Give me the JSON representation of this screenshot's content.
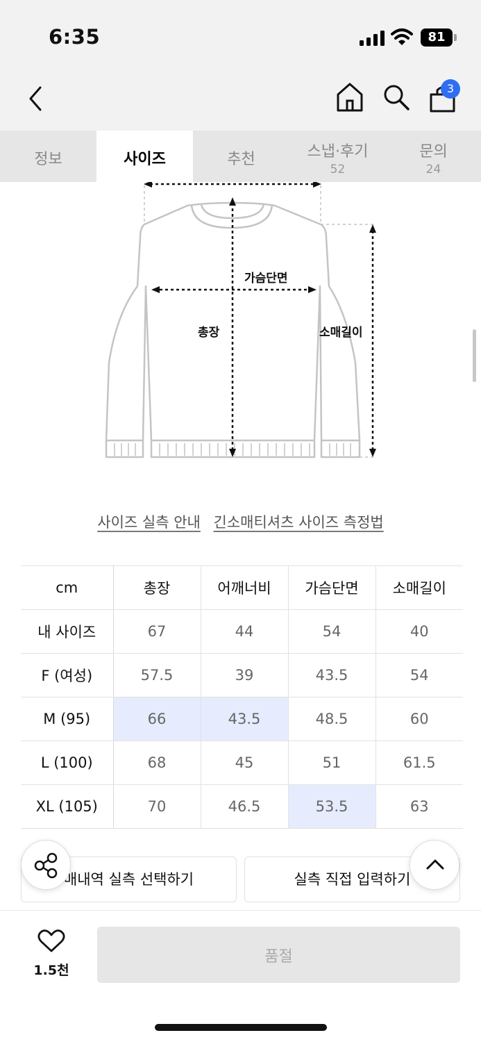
{
  "status_bar": {
    "time": "6:35",
    "battery": "81",
    "icons": [
      "signal-icon",
      "wifi-icon",
      "battery-icon"
    ]
  },
  "nav": {
    "icons": [
      "back-arrow-icon",
      "home-icon",
      "search-icon",
      "cart-icon"
    ],
    "cart_badge": "3"
  },
  "tabs": [
    {
      "label": "정보",
      "count": ""
    },
    {
      "label": "사이즈",
      "count": ""
    },
    {
      "label": "추천",
      "count": ""
    },
    {
      "label": "스냅·후기",
      "count": "52"
    },
    {
      "label": "문의",
      "count": "24"
    }
  ],
  "active_tab": "사이즈",
  "diagram": {
    "chest_label": "가슴단면",
    "length_label": "총장",
    "sleeve_label": "소매길이"
  },
  "guide_links": {
    "size_guide": "사이즈 실측 안내",
    "measure_method": "긴소매티셔츠 사이즈 측정법"
  },
  "size_table": {
    "headers": [
      "cm",
      "총장",
      "어깨너비",
      "가슴단면",
      "소매길이"
    ],
    "rows": [
      [
        "내 사이즈",
        "67",
        "44",
        "54",
        "40"
      ],
      [
        "F (여성)",
        "57.5",
        "39",
        "43.5",
        "54"
      ],
      [
        "M (95)",
        "66",
        "43.5",
        "48.5",
        "60"
      ],
      [
        "L (100)",
        "68",
        "45",
        "51",
        "61.5"
      ],
      [
        "XL (105)",
        "70",
        "46.5",
        "53.5",
        "63"
      ]
    ],
    "highlight_color": "#e6ecfd"
  },
  "actions": {
    "purchase_history": "매내역 실측 선택하기",
    "direct_input": "실측 직접 입력하기"
  },
  "floating": {
    "icons": [
      "share-icon",
      "chevron-up-icon"
    ]
  },
  "bottom_bar": {
    "like_count": "1.5천",
    "buy_label": "품절"
  },
  "colors": {
    "accent": "#2f6ef3",
    "header_bg": "#f2f2f2"
  }
}
